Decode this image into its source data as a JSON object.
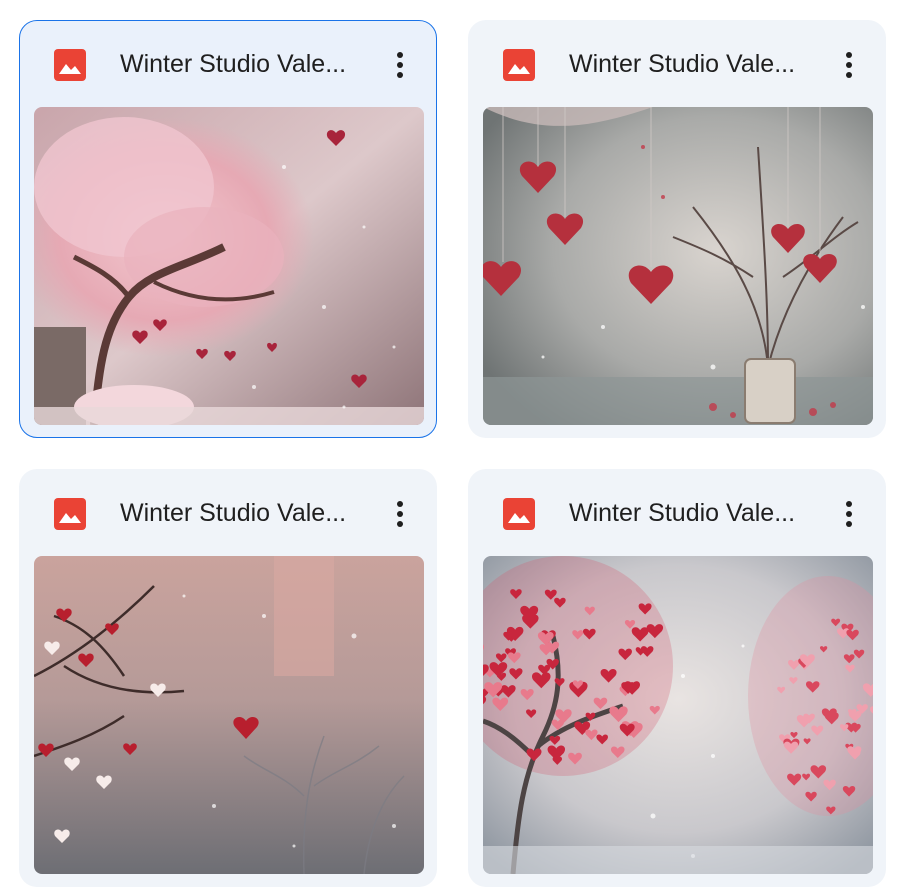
{
  "files": [
    {
      "title": "Winter Studio Vale...",
      "type_icon": "image-file-icon",
      "selected": true
    },
    {
      "title": "Winter Studio Vale...",
      "type_icon": "image-file-icon",
      "selected": false
    },
    {
      "title": "Winter Studio Vale...",
      "type_icon": "image-file-icon",
      "selected": false
    },
    {
      "title": "Winter Studio Vale...",
      "type_icon": "image-file-icon",
      "selected": false
    }
  ],
  "colors": {
    "file_icon": "#ea4335",
    "selection_border": "#1a73e8",
    "card_background": "#f0f4f9"
  }
}
